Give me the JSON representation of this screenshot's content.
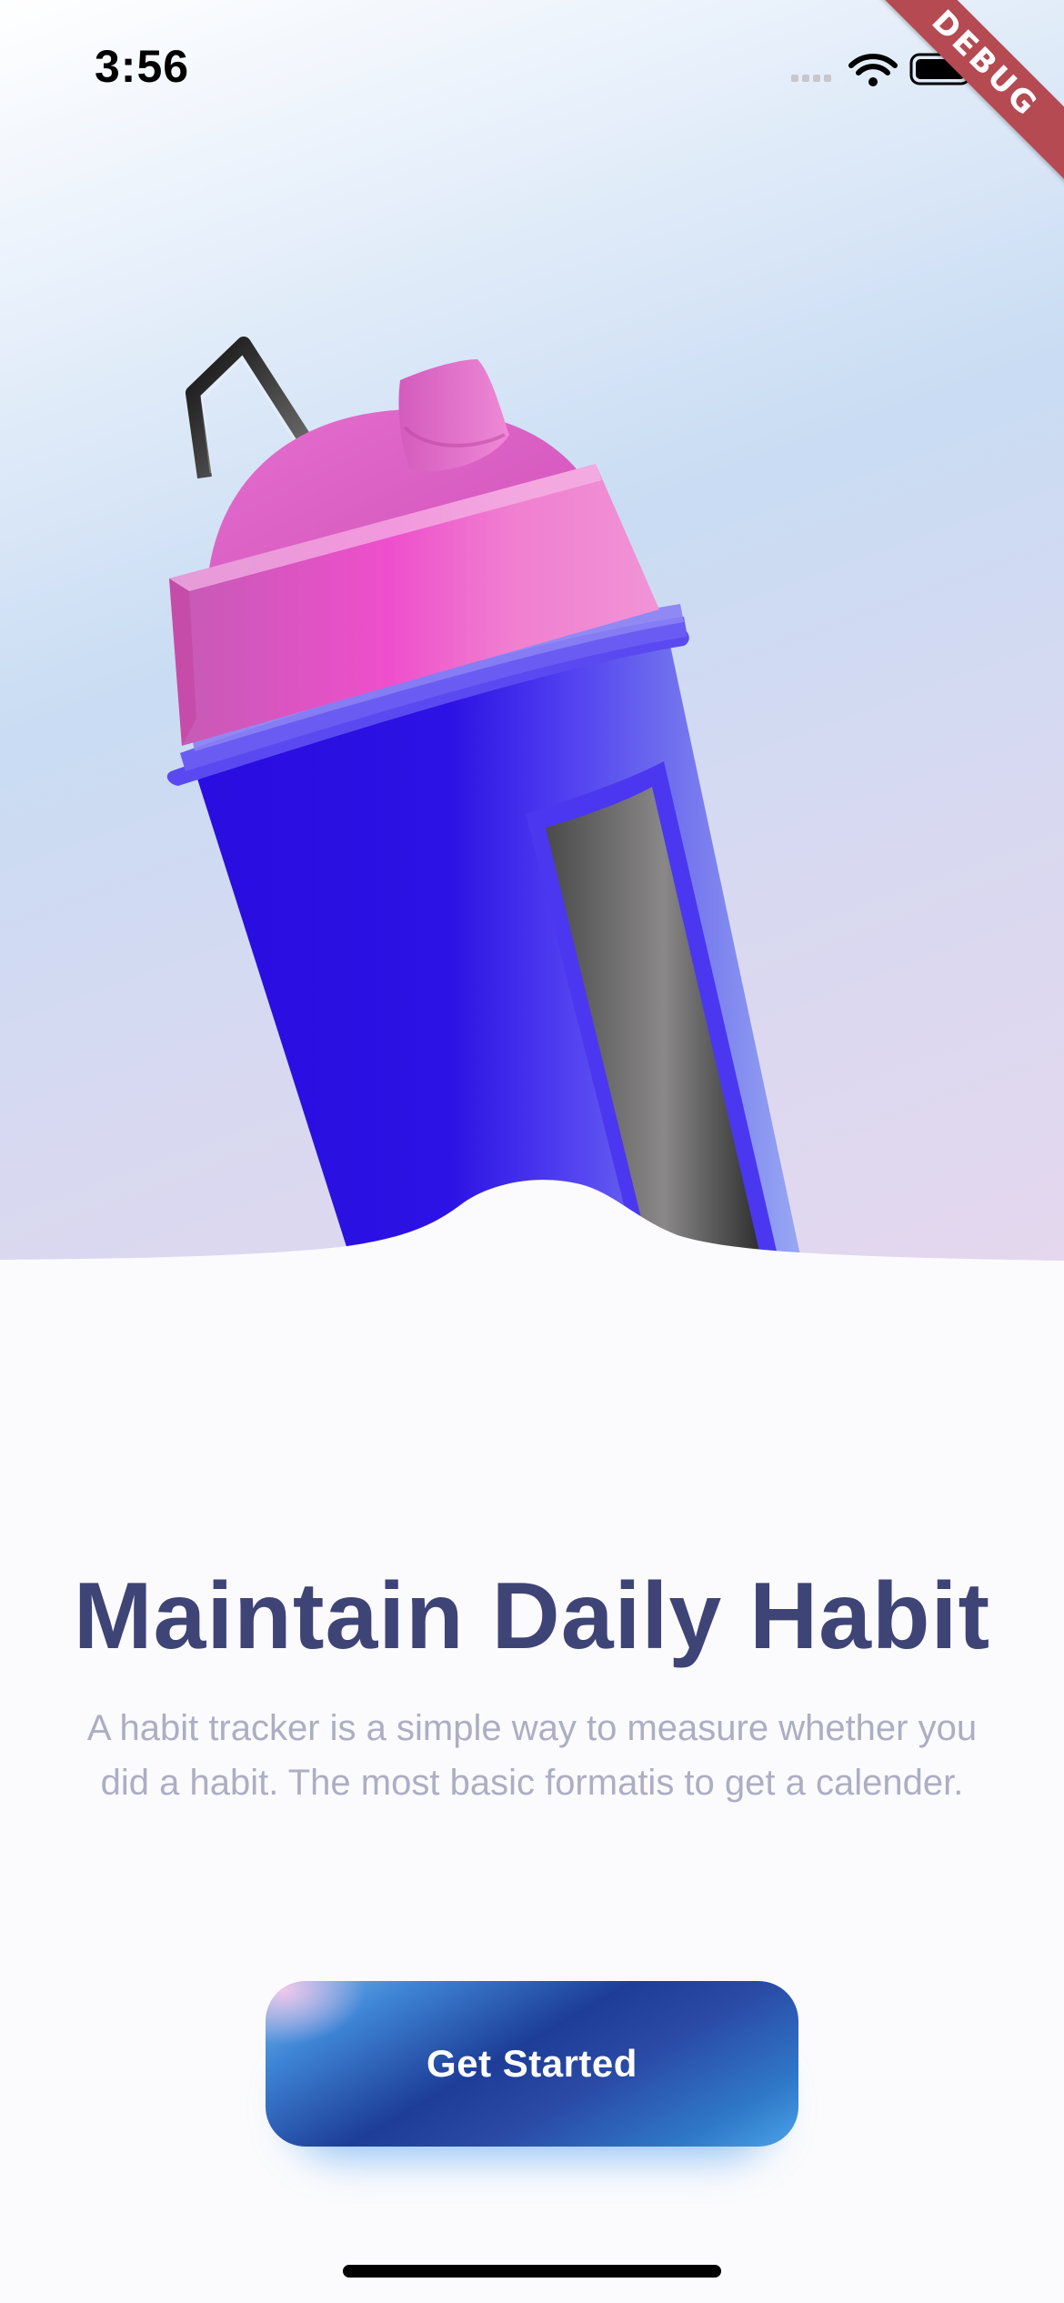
{
  "status_bar": {
    "time": "3:56",
    "icons": [
      "cellular-icon",
      "wifi-icon",
      "battery-icon"
    ],
    "debug_label": "DEBUG"
  },
  "hero": {
    "illustration": "water-bottle-illustration"
  },
  "content": {
    "title": "Maintain Daily Habit",
    "description": "A habit tracker is a simple way to measure whether you did a habit. The most basic formatis to get a calender."
  },
  "cta": {
    "label": "Get Started"
  },
  "colors": {
    "title": "#3f4476",
    "description": "#adadc4",
    "bottle_body": "#2a14e0",
    "bottle_cap": "#e761c9",
    "cta_dark": "#1d3d98",
    "cta_light": "#4aa3e8"
  }
}
